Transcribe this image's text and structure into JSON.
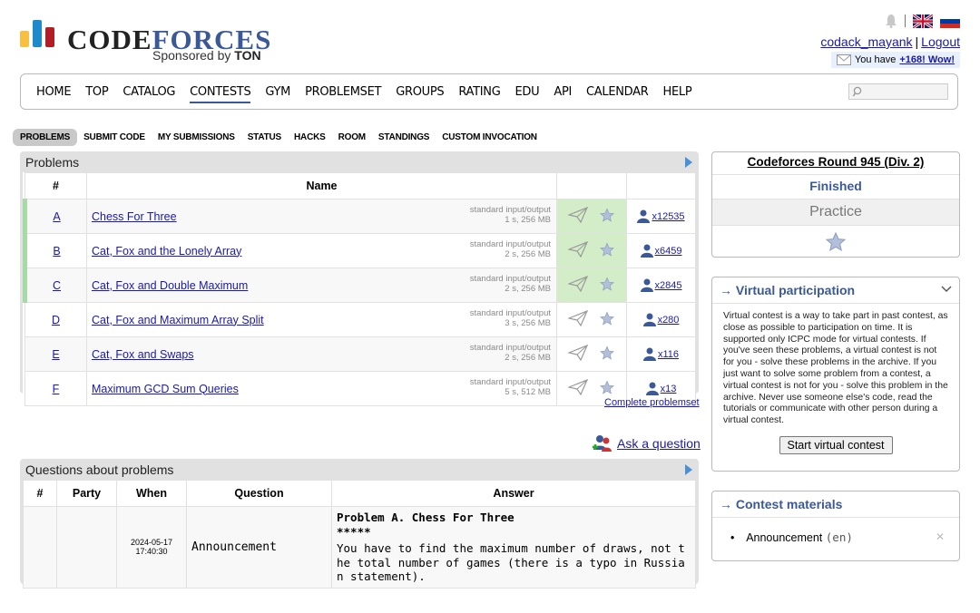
{
  "logo": {
    "word_a": "CODE",
    "word_b": "FORCES",
    "sponsor_prefix": "Sponsored by",
    "sponsor_name": "TON"
  },
  "header": {
    "username": "codack_mayank",
    "separator": "|",
    "logout": "Logout",
    "msg_prefix": "You have",
    "msg_link": "+168! Wow!"
  },
  "menu": [
    "HOME",
    "TOP",
    "CATALOG",
    "CONTESTS",
    "GYM",
    "PROBLEMSET",
    "GROUPS",
    "RATING",
    "EDU",
    "API",
    "CALENDAR",
    "HELP"
  ],
  "submenu": [
    "PROBLEMS",
    "SUBMIT CODE",
    "MY SUBMISSIONS",
    "STATUS",
    "HACKS",
    "ROOM",
    "STANDINGS",
    "CUSTOM INVOCATION"
  ],
  "problems": {
    "title": "Problems",
    "headers": {
      "idx": "#",
      "name": "Name"
    },
    "rows": [
      {
        "idx": "A",
        "name": "Chess For Three",
        "io": "standard input/output",
        "limits": "1 s, 256 MB",
        "count": "x12535",
        "solved": true
      },
      {
        "idx": "B",
        "name": "Cat, Fox and the Lonely Array",
        "io": "standard input/output",
        "limits": "2 s, 256 MB",
        "count": "x6459",
        "solved": true
      },
      {
        "idx": "C",
        "name": "Cat, Fox and Double Maximum",
        "io": "standard input/output",
        "limits": "2 s, 256 MB",
        "count": "x2845",
        "solved": true
      },
      {
        "idx": "D",
        "name": "Cat, Fox and Maximum Array Split",
        "io": "standard input/output",
        "limits": "3 s, 256 MB",
        "count": "x280",
        "solved": false
      },
      {
        "idx": "E",
        "name": "Cat, Fox and Swaps",
        "io": "standard input/output",
        "limits": "2 s, 256 MB",
        "count": "x116",
        "solved": false
      },
      {
        "idx": "F",
        "name": "Maximum GCD Sum Queries",
        "io": "standard input/output",
        "limits": "5 s, 512 MB",
        "count": "x13",
        "solved": false
      }
    ],
    "complete_link": "Complete problemset"
  },
  "ask": {
    "label": "Ask a question"
  },
  "questions": {
    "title": "Questions about problems",
    "headers": {
      "idx": "#",
      "party": "Party",
      "when": "When",
      "question": "Question",
      "answer": "Answer"
    },
    "row": {
      "date": "2024-05-17",
      "time": "17:40:30",
      "question": "Announcement",
      "answer_title": "Problem A. Chess For Three",
      "answer_stars": "*****",
      "answer_line1": "You have to find the maximum number of draws, not t",
      "answer_line2": "he total number of games (there is a typo in Russia",
      "answer_line3": "n statement)."
    }
  },
  "sidebar": {
    "contest_name": "Codeforces Round 945 (Div. 2)",
    "status": "Finished",
    "practice": "Practice",
    "virtual_title": "→ Virtual participation",
    "virtual_text": "Virtual contest is a way to take part in past contest, as close as possible to participation on time. It is supported only ICPC mode for virtual contests. If you've seen these problems, a virtual contest is not for you - solve these problems in the archive. If you just want to solve some problem from a contest, a virtual contest is not for you - solve this problem in the archive. Never use someone else's code, read the tutorials or communicate with other person during a virtual contest.",
    "virtual_button": "Start virtual contest",
    "materials_title": "→ Contest materials",
    "material_item": "Announcement",
    "material_lang": "(en)"
  },
  "colors": {
    "accent": "#3b5998",
    "solved": "#d4edc9",
    "link": "#1a1aa6"
  }
}
